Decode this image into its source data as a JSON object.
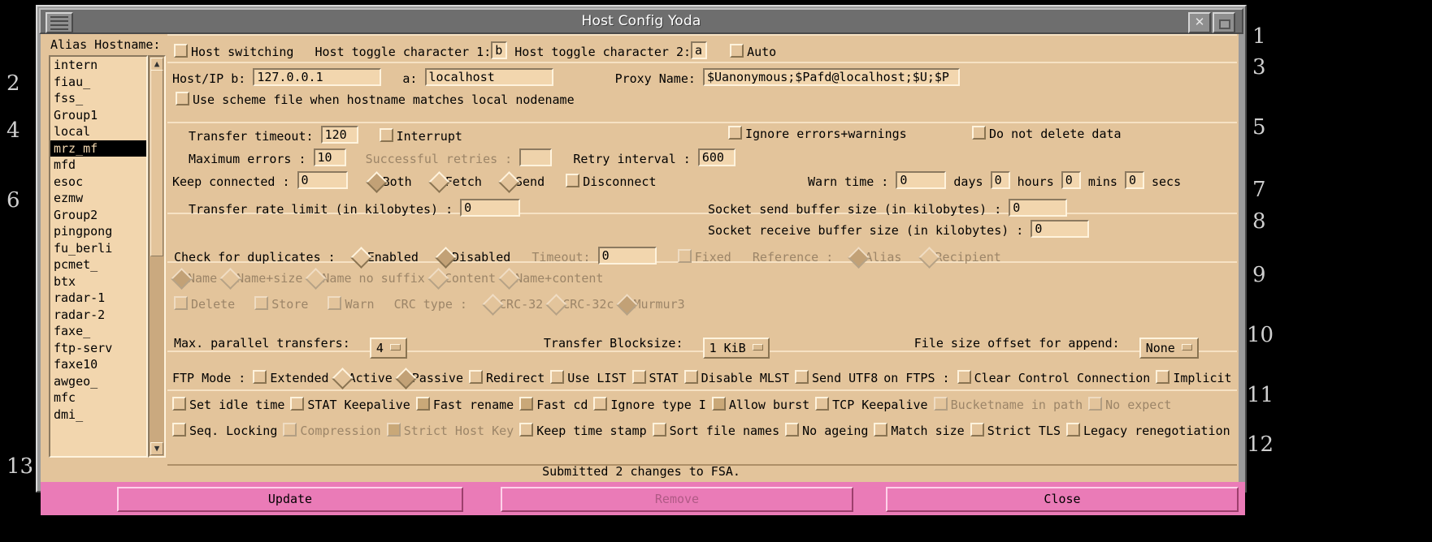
{
  "window": {
    "title": "Host Config Yoda",
    "close_icon": "close-icon",
    "maximize_icon": "maximize-icon",
    "menu_icon": "window-menu-icon"
  },
  "sidebar": {
    "label": "Alias Hostname:",
    "selected": "mrz_mf",
    "items": [
      "intern",
      "fiau_",
      "fss_",
      "Group1",
      "local",
      "mrz_mf",
      "mfd",
      "esoc",
      "ezmw",
      "Group2",
      "pingpong",
      "fu_berli",
      "pcmet_",
      "btx",
      "radar-1",
      "radar-2",
      "faxe_",
      "ftp-serv",
      "faxe10",
      "awgeo_",
      "mfc",
      "dmi_"
    ],
    "scroll_up": "▲",
    "scroll_down": "▼"
  },
  "section1": {
    "host_switching_label": "Host switching",
    "host_switching_checked": false,
    "toggle1_label": "Host toggle character 1:",
    "toggle1_value": "b",
    "toggle2_label": "Host toggle character 2:",
    "toggle2_value": "a",
    "auto_label": "Auto",
    "auto_checked": false
  },
  "section2": {
    "hostip_b_label": "Host/IP b:",
    "hostip_b_value": "127.0.0.1",
    "hostip_a_label": "a:",
    "hostip_a_value": "localhost",
    "proxy_label": "Proxy Name:",
    "proxy_value": "$Uanonymous;$Pafd@localhost;$U;$P",
    "scheme_label": "Use scheme file when hostname matches local nodename",
    "scheme_checked": false
  },
  "section_transfer": {
    "transfer_timeout_label": "Transfer timeout:",
    "transfer_timeout_value": "120",
    "interrupt_label": "Interrupt",
    "interrupt_checked": false,
    "ignore_errors_label": "Ignore errors+warnings",
    "ignore_errors_checked": false,
    "do_not_delete_label": "Do not delete data",
    "do_not_delete_checked": false,
    "max_errors_label": "Maximum errors  :",
    "max_errors_value": "10",
    "successful_retries_label": "Successful retries :",
    "successful_retries_value": "",
    "retry_interval_label": "Retry interval :",
    "retry_interval_value": "600",
    "keep_connected_label": "Keep connected  :",
    "keep_connected_value": "0",
    "kc_both": "Both",
    "kc_fetch": "Fetch",
    "kc_send": "Send",
    "kc_selected": "Both",
    "disconnect_label": "Disconnect",
    "disconnect_checked": false,
    "warn_time_label": "Warn time :",
    "warn_days_value": "0",
    "warn_days_unit": "days",
    "warn_hours_value": "0",
    "warn_hours_unit": "hours",
    "warn_mins_value": "0",
    "warn_mins_unit": "mins",
    "warn_secs_value": "0",
    "warn_secs_unit": "secs"
  },
  "section_rate": {
    "rate_limit_label": "Transfer rate limit (in kilobytes) :",
    "rate_limit_value": "0",
    "send_buf_label": "Socket send buffer size (in kilobytes)    :",
    "send_buf_value": "0",
    "recv_buf_label": "Socket receive buffer size (in kilobytes) :",
    "recv_buf_value": "0"
  },
  "section_dupcheck": {
    "check_dup_label": "Check for duplicates :",
    "enabled_label": "Enabled",
    "disabled_label": "Disabled",
    "dup_selected": "Disabled",
    "timeout_label": "Timeout:",
    "timeout_value": "0",
    "fixed_label": "Fixed",
    "fixed_checked": false,
    "reference_label": "Reference :",
    "ref_alias_label": "Alias",
    "ref_recipient_label": "Recipient",
    "ref_selected": "Alias",
    "modes": [
      "Name",
      "Name+size",
      "Name no suffix",
      "Content",
      "Name+content"
    ],
    "mode_selected": "Name",
    "delete_label": "Delete",
    "store_label": "Store",
    "warn_label": "Warn",
    "crc_type_label": "CRC type :",
    "crc_options": [
      "CRC-32",
      "CRC-32c",
      "Murmur3"
    ],
    "crc_selected": "Murmur3"
  },
  "section_parallel": {
    "max_parallel_label": "Max. parallel transfers:",
    "max_parallel_value": "4",
    "blocksize_label": "Transfer Blocksize:",
    "blocksize_value": "1 KiB",
    "offset_label": "File size offset for append:",
    "offset_value": "None"
  },
  "section_ftp": {
    "ftp_mode_label": "FTP Mode :",
    "extended_label": "Extended",
    "extended_checked": false,
    "active_label": "Active",
    "passive_label": "Passive",
    "mode_selected": "Passive",
    "row1": [
      {
        "label": "Redirect",
        "checked": false,
        "disabled": false
      },
      {
        "label": "Use LIST",
        "checked": false,
        "disabled": false
      },
      {
        "label": "STAT",
        "checked": false,
        "disabled": false
      },
      {
        "label": "Disable MLST",
        "checked": false,
        "disabled": false
      },
      {
        "label": "Send UTF8",
        "checked": false,
        "disabled": false
      }
    ],
    "ftps_label": "on FTPS :",
    "row1_tail": [
      {
        "label": "Clear Control Connection",
        "checked": false,
        "disabled": false
      },
      {
        "label": "Implicit",
        "checked": false,
        "disabled": false
      }
    ],
    "row2": [
      {
        "label": "Set idle time",
        "checked": false,
        "disabled": false
      },
      {
        "label": "STAT Keepalive",
        "checked": false,
        "disabled": false
      },
      {
        "label": "Fast rename",
        "checked": true,
        "disabled": false
      },
      {
        "label": "Fast cd",
        "checked": true,
        "disabled": false
      },
      {
        "label": "Ignore type I",
        "checked": false,
        "disabled": false
      },
      {
        "label": "Allow burst",
        "checked": true,
        "disabled": false
      },
      {
        "label": "TCP Keepalive",
        "checked": false,
        "disabled": false
      },
      {
        "label": "Bucketname in path",
        "checked": false,
        "disabled": true
      },
      {
        "label": "No expect",
        "checked": false,
        "disabled": true
      }
    ],
    "row3": [
      {
        "label": "Seq. Locking",
        "checked": false,
        "disabled": false
      },
      {
        "label": "Compression",
        "checked": false,
        "disabled": true
      },
      {
        "label": "Strict Host Key",
        "checked": true,
        "disabled": true
      },
      {
        "label": "Keep time stamp",
        "checked": false,
        "disabled": false
      },
      {
        "label": "Sort file names",
        "checked": false,
        "disabled": false
      },
      {
        "label": "No ageing",
        "checked": false,
        "disabled": false
      },
      {
        "label": "Match size",
        "checked": false,
        "disabled": false
      },
      {
        "label": "Strict TLS",
        "checked": false,
        "disabled": false
      },
      {
        "label": "Legacy renegotiation",
        "checked": false,
        "disabled": false
      }
    ]
  },
  "status": {
    "message": "Submitted 2 changes to FSA."
  },
  "buttons": {
    "update": "Update",
    "remove": "Remove",
    "close": "Close"
  },
  "annotations": [
    "1",
    "2",
    "3",
    "4",
    "5",
    "6",
    "7",
    "8",
    "9",
    "10",
    "11",
    "12",
    "13"
  ]
}
